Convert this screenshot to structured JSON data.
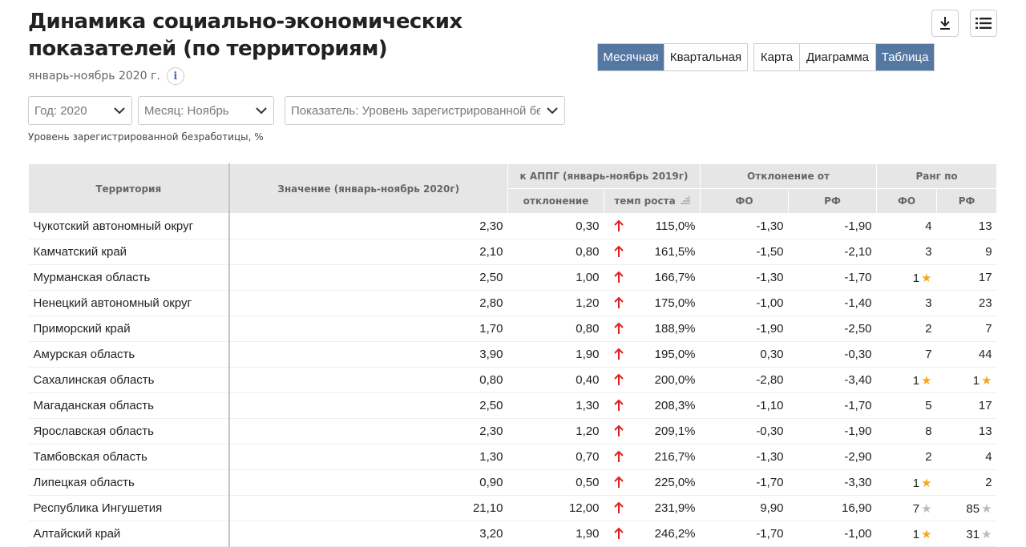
{
  "header": {
    "title_line1": "Динамика социально-экономических",
    "title_line2": "показателей (по территориям)",
    "subtitle": "январь-ноябрь 2020 г.",
    "info_icon": "i"
  },
  "toolbar": {
    "download_icon": "download-icon",
    "menu_icon": "list-menu-icon"
  },
  "period_toggle": {
    "monthly": "Месячная",
    "quarterly": "Квартальная"
  },
  "view_toggle": {
    "map": "Карта",
    "diagram": "Диаграмма",
    "table": "Таблица"
  },
  "filters": {
    "year": "Год: 2020",
    "month": "Месяц: Ноябрь",
    "indicator": "Показатель: Уровень зарегистрированной безработицы, %"
  },
  "caption": "Уровень зарегистрированной безработицы, %",
  "table": {
    "headers": {
      "territory": "Территория",
      "value": "Значение (январь-ноябрь 2020г)",
      "appg": "к АППГ (январь-ноябрь 2019г)",
      "deviation": "отклонение",
      "growth": "темп роста",
      "deviation_from": "Отклонение от",
      "fo": "ФО",
      "rf": "РФ",
      "rank": "Ранг по",
      "rank_fo": "ФО",
      "rank_rf": "РФ"
    },
    "rows": [
      {
        "territory": "Чукотский автономный округ",
        "value": "2,30",
        "dev": "0,30",
        "growth": "115,0%",
        "fo": "-1,30",
        "rf": "-1,90",
        "rank_fo": "4",
        "rank_fo_star": "",
        "rank_rf": "13",
        "rank_rf_star": ""
      },
      {
        "territory": "Камчатский край",
        "value": "2,10",
        "dev": "0,80",
        "growth": "161,5%",
        "fo": "-1,50",
        "rf": "-2,10",
        "rank_fo": "3",
        "rank_fo_star": "",
        "rank_rf": "9",
        "rank_rf_star": ""
      },
      {
        "territory": "Мурманская область",
        "value": "2,50",
        "dev": "1,00",
        "growth": "166,7%",
        "fo": "-1,30",
        "rf": "-1,70",
        "rank_fo": "1",
        "rank_fo_star": "gold",
        "rank_rf": "17",
        "rank_rf_star": ""
      },
      {
        "territory": "Ненецкий автономный округ",
        "value": "2,80",
        "dev": "1,20",
        "growth": "175,0%",
        "fo": "-1,00",
        "rf": "-1,40",
        "rank_fo": "3",
        "rank_fo_star": "",
        "rank_rf": "23",
        "rank_rf_star": ""
      },
      {
        "territory": "Приморский край",
        "value": "1,70",
        "dev": "0,80",
        "growth": "188,9%",
        "fo": "-1,90",
        "rf": "-2,50",
        "rank_fo": "2",
        "rank_fo_star": "",
        "rank_rf": "7",
        "rank_rf_star": ""
      },
      {
        "territory": "Амурская область",
        "value": "3,90",
        "dev": "1,90",
        "growth": "195,0%",
        "fo": "0,30",
        "rf": "-0,30",
        "rank_fo": "7",
        "rank_fo_star": "",
        "rank_rf": "44",
        "rank_rf_star": ""
      },
      {
        "territory": "Сахалинская область",
        "value": "0,80",
        "dev": "0,40",
        "growth": "200,0%",
        "fo": "-2,80",
        "rf": "-3,40",
        "rank_fo": "1",
        "rank_fo_star": "gold",
        "rank_rf": "1",
        "rank_rf_star": "gold"
      },
      {
        "territory": "Магаданская область",
        "value": "2,50",
        "dev": "1,30",
        "growth": "208,3%",
        "fo": "-1,10",
        "rf": "-1,70",
        "rank_fo": "5",
        "rank_fo_star": "",
        "rank_rf": "17",
        "rank_rf_star": ""
      },
      {
        "territory": "Ярославская область",
        "value": "2,30",
        "dev": "1,20",
        "growth": "209,1%",
        "fo": "-0,30",
        "rf": "-1,90",
        "rank_fo": "8",
        "rank_fo_star": "",
        "rank_rf": "13",
        "rank_rf_star": ""
      },
      {
        "territory": "Тамбовская область",
        "value": "1,30",
        "dev": "0,70",
        "growth": "216,7%",
        "fo": "-1,30",
        "rf": "-2,90",
        "rank_fo": "2",
        "rank_fo_star": "",
        "rank_rf": "4",
        "rank_rf_star": ""
      },
      {
        "territory": "Липецкая область",
        "value": "0,90",
        "dev": "0,50",
        "growth": "225,0%",
        "fo": "-1,70",
        "rf": "-3,30",
        "rank_fo": "1",
        "rank_fo_star": "gold",
        "rank_rf": "2",
        "rank_rf_star": ""
      },
      {
        "territory": "Республика Ингушетия",
        "value": "21,10",
        "dev": "12,00",
        "growth": "231,9%",
        "fo": "9,90",
        "rf": "16,90",
        "rank_fo": "7",
        "rank_fo_star": "gray",
        "rank_rf": "85",
        "rank_rf_star": "gray"
      },
      {
        "territory": "Алтайский край",
        "value": "3,20",
        "dev": "1,90",
        "growth": "246,2%",
        "fo": "-1,70",
        "rf": "-1,00",
        "rank_fo": "1",
        "rank_fo_star": "gold",
        "rank_rf": "31",
        "rank_rf_star": "gray"
      }
    ]
  },
  "colors": {
    "active_toggle": "#5578a3",
    "arrow_up": "#e02020",
    "star_gold": "#f5a623",
    "star_gray": "#bbbbbb"
  }
}
